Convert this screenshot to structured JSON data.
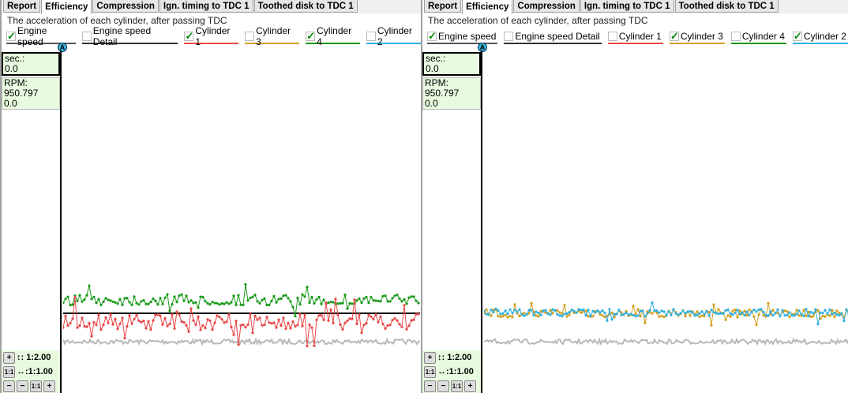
{
  "panels": [
    {
      "tabs": [
        "Report",
        "Efficiency",
        "Compression",
        "Ign. timing to TDC 1",
        "Toothed disk to TDC 1"
      ],
      "active_tab": 1,
      "subtitle": "The acceleration of each cylinder, after passing TDC",
      "legend": [
        {
          "label": "Engine speed",
          "checked": true,
          "color": "#555555"
        },
        {
          "label": "Engine speed Detail",
          "checked": false,
          "color": "#333333"
        },
        {
          "label": "Cylinder 1",
          "checked": true,
          "color": "#e84848"
        },
        {
          "label": "Cylinder 3",
          "checked": false,
          "color": "#d4a020"
        },
        {
          "label": "Cylinder 4",
          "checked": true,
          "color": "#1a9a1a"
        },
        {
          "label": "Cylinder 2",
          "checked": false,
          "color": "#30b0e0"
        }
      ],
      "cursor_label": "A",
      "sec_label": "sec.:",
      "sec_value": "0.0",
      "rpm_label": "RPM:",
      "rpm_value": "950.797",
      "rpm_sub": "0.0",
      "v_scale": "↕: 1:2.00",
      "h_scale": "↔:1:1.00"
    },
    {
      "tabs": [
        "Report",
        "Efficiency",
        "Compression",
        "Ign. timing to TDC 1",
        "Toothed disk to TDC 1"
      ],
      "active_tab": 1,
      "subtitle": "The acceleration of each cylinder, after passing TDC",
      "legend": [
        {
          "label": "Engine speed",
          "checked": true,
          "color": "#555555"
        },
        {
          "label": "Engine speed Detail",
          "checked": false,
          "color": "#333333"
        },
        {
          "label": "Cylinder 1",
          "checked": false,
          "color": "#e84848"
        },
        {
          "label": "Cylinder 3",
          "checked": true,
          "color": "#d4a020"
        },
        {
          "label": "Cylinder 4",
          "checked": false,
          "color": "#1a9a1a"
        },
        {
          "label": "Cylinder 2",
          "checked": true,
          "color": "#30b0e0"
        }
      ],
      "cursor_label": "A",
      "sec_label": "sec.:",
      "sec_value": "0.0",
      "rpm_label": "RPM:",
      "rpm_value": "950.797",
      "rpm_sub": "0.0",
      "v_scale": "↕: 1:2.00",
      "h_scale": "↔:1:1.00"
    }
  ],
  "buttons": {
    "plus": "+",
    "minus": "−",
    "one": "1:1"
  }
}
